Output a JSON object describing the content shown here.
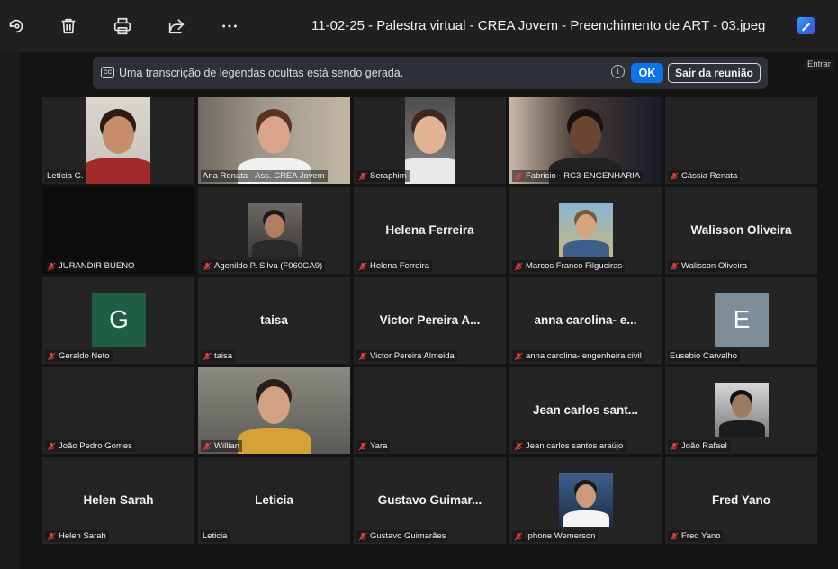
{
  "file_title": "11-02-25 - Palestra virtual - CREA Jovem - Preenchimento de ART - 03.jpeg",
  "toolbar_icons": [
    "rotate-icon",
    "delete-icon",
    "print-icon",
    "share-icon",
    "more-icon",
    "enhance-icon"
  ],
  "caption_bar": {
    "cc_label": "CC",
    "text": "Uma transcrição de legendas ocultas está sendo gerada.",
    "ok_label": "OK",
    "leave_label": "Sair da reunião"
  },
  "enter_label": "Entrar",
  "accent_color": "#c8e64a",
  "participants": [
    {
      "tag": "Letícia G.",
      "muted": false,
      "kind": "video"
    },
    {
      "tag": "Ana Renata - Ass. CREA Jovem",
      "muted": false,
      "kind": "video",
      "active": true
    },
    {
      "tag": "Seraphim",
      "muted": true,
      "kind": "video"
    },
    {
      "tag": "Fabricio - RC3-ENGENHARIA",
      "muted": true,
      "kind": "video"
    },
    {
      "tag": "Cássia Renata",
      "muted": true,
      "kind": "blank"
    },
    {
      "tag": "JURANDIR BUENO",
      "muted": true,
      "kind": "black"
    },
    {
      "tag": "Agenildo P. Silva (F060GA9)",
      "muted": true,
      "kind": "photo"
    },
    {
      "tag": "Helena Ferreira",
      "muted": true,
      "kind": "name",
      "display": "Helena Ferreira"
    },
    {
      "tag": "Marcos Franco Filgueiras",
      "muted": true,
      "kind": "photo"
    },
    {
      "tag": "Walisson Oliveira",
      "muted": true,
      "kind": "name",
      "display": "Walisson Oliveira"
    },
    {
      "tag": "Geraldo Neto",
      "muted": true,
      "kind": "avatar",
      "letter": "G",
      "color": "#1e5e45"
    },
    {
      "tag": "taisa",
      "muted": true,
      "kind": "name",
      "display": "taisa"
    },
    {
      "tag": "Victor Pereira Almeida",
      "muted": true,
      "kind": "name",
      "display": "Victor Pereira A..."
    },
    {
      "tag": "anna carolina- engenheira civil",
      "muted": true,
      "kind": "name",
      "display": "anna carolina- e..."
    },
    {
      "tag": "Eusebio Carvalho",
      "muted": false,
      "kind": "avatar",
      "letter": "E",
      "color": "#7d8d9a"
    },
    {
      "tag": "João Pedro Gomes",
      "muted": true,
      "kind": "blank"
    },
    {
      "tag": "Willian",
      "muted": true,
      "kind": "video"
    },
    {
      "tag": "Yara",
      "muted": true,
      "kind": "blank"
    },
    {
      "tag": "Jean carlos santos araújo",
      "muted": true,
      "kind": "name",
      "display": "Jean carlos sant..."
    },
    {
      "tag": "João Rafael",
      "muted": true,
      "kind": "photo"
    },
    {
      "tag": "Helen Sarah",
      "muted": true,
      "kind": "name",
      "display": "Helen Sarah"
    },
    {
      "tag": "Leticia",
      "muted": false,
      "kind": "name",
      "display": "Leticia"
    },
    {
      "tag": "Gustavo Guimarães",
      "muted": true,
      "kind": "name",
      "display": "Gustavo Guimar..."
    },
    {
      "tag": "Iphone Wemerson",
      "muted": true,
      "kind": "photo"
    },
    {
      "tag": "Fred Yano",
      "muted": true,
      "kind": "name",
      "display": "Fred Yano"
    }
  ]
}
